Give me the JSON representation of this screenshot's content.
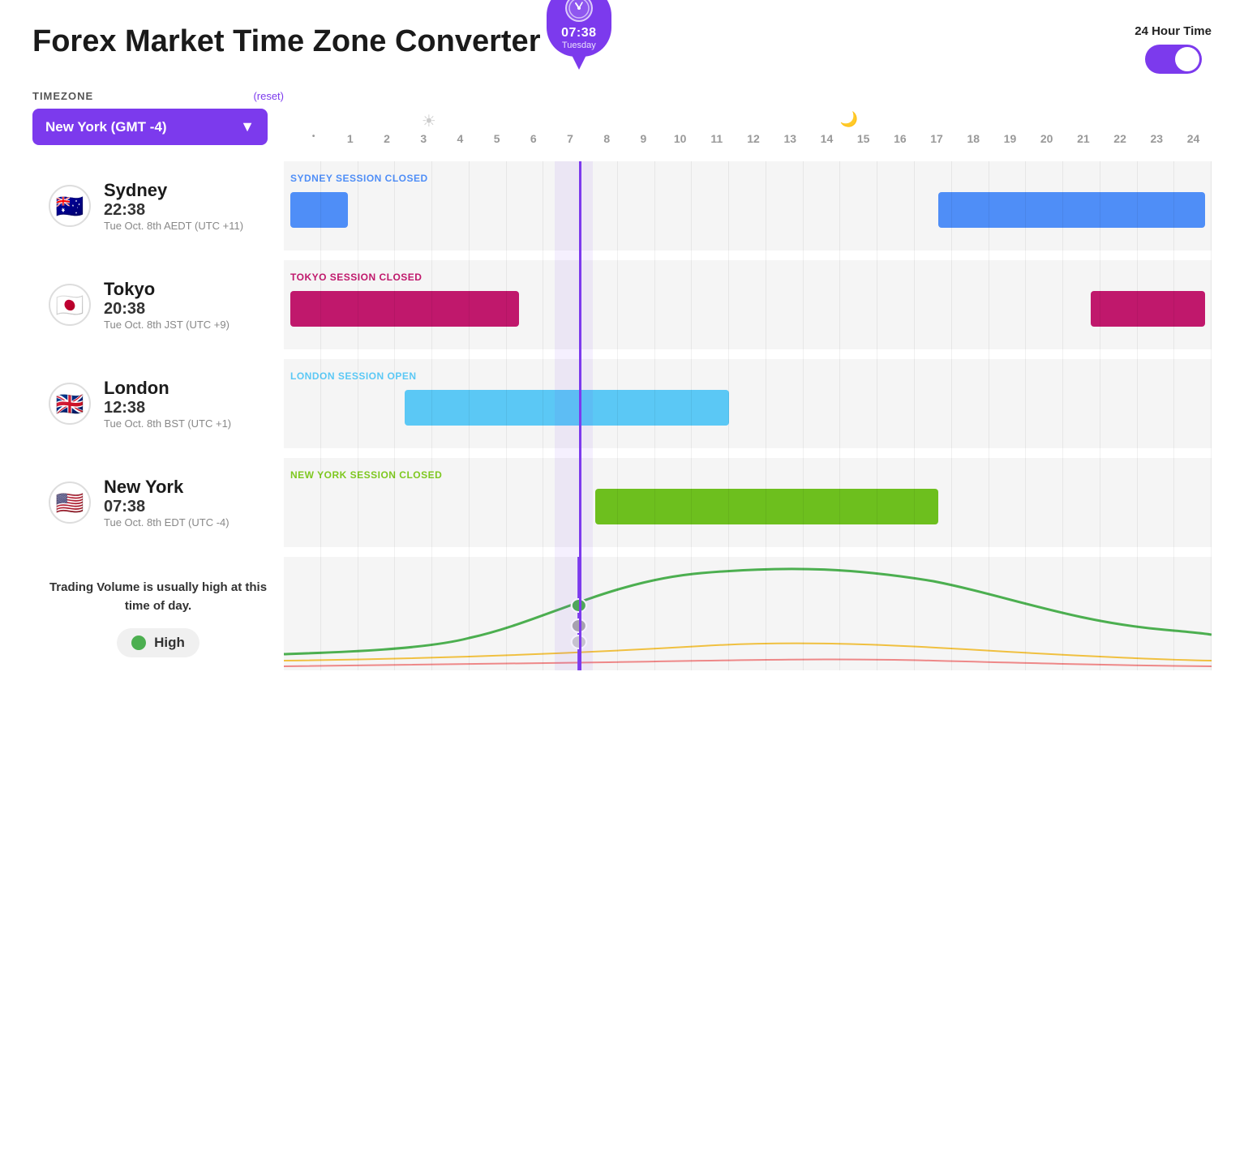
{
  "title": "Forex Market Time Zone Converter",
  "toggle": {
    "label": "24 Hour Time",
    "enabled": true
  },
  "timezone": {
    "label": "TIMEZONE",
    "reset": "(reset)",
    "selected": "New York (GMT -4)"
  },
  "currentTime": {
    "time": "07:38",
    "day": "Tuesday",
    "position": 7.633
  },
  "timeAxis": {
    "ticks": [
      "•",
      "1",
      "2",
      "3",
      "4",
      "5",
      "6",
      "7",
      "8",
      "9",
      "10",
      "11",
      "12",
      "13",
      "14",
      "15",
      "16",
      "17",
      "18",
      "19",
      "20",
      "21",
      "22",
      "23",
      "24"
    ]
  },
  "sessions": [
    {
      "city": "Sydney",
      "flag": "🇦🇺",
      "time": "22:38",
      "date": "Tue Oct. 8th AEDT (UTC +11)",
      "status": "SYDNEY SESSION CLOSED",
      "statusColor": "#4f8ef7",
      "color": "#4f8ef7",
      "bars": [
        {
          "start": 0,
          "end": 1.5,
          "width_pct": 6.25
        },
        {
          "start": 17,
          "end": 24,
          "width_pct": 29.2
        }
      ]
    },
    {
      "city": "Tokyo",
      "flag": "🇯🇵",
      "time": "20:38",
      "date": "Tue Oct. 8th JST (UTC +9)",
      "status": "TOKYO SESSION CLOSED",
      "statusColor": "#c0186c",
      "color": "#c0186c",
      "bars": [
        {
          "start": 0,
          "end": 6,
          "width_pct": 25
        },
        {
          "start": 21,
          "end": 24,
          "width_pct": 12.5
        }
      ]
    },
    {
      "city": "London",
      "flag": "🇬🇧",
      "time": "12:38",
      "date": "Tue Oct. 8th BST (UTC +1)",
      "status": "LONDON SESSION OPEN",
      "statusColor": "#5bc8f5",
      "color": "#5bc8f5",
      "bars": [
        {
          "start": 3,
          "end": 11.5,
          "width_pct": 35.4
        }
      ]
    },
    {
      "city": "New York",
      "flag": "🇺🇸",
      "time": "07:38",
      "date": "Tue Oct. 8th EDT (UTC -4)",
      "status": "NEW YORK SESSION CLOSED",
      "statusColor": "#7ec820",
      "color": "#6dbf1e",
      "bars": [
        {
          "start": 8,
          "end": 17,
          "width_pct": 37.5
        }
      ]
    }
  ],
  "volume": {
    "text": "Trading Volume is usually high at this time of day.",
    "level": "High",
    "color": "#4caf50"
  }
}
